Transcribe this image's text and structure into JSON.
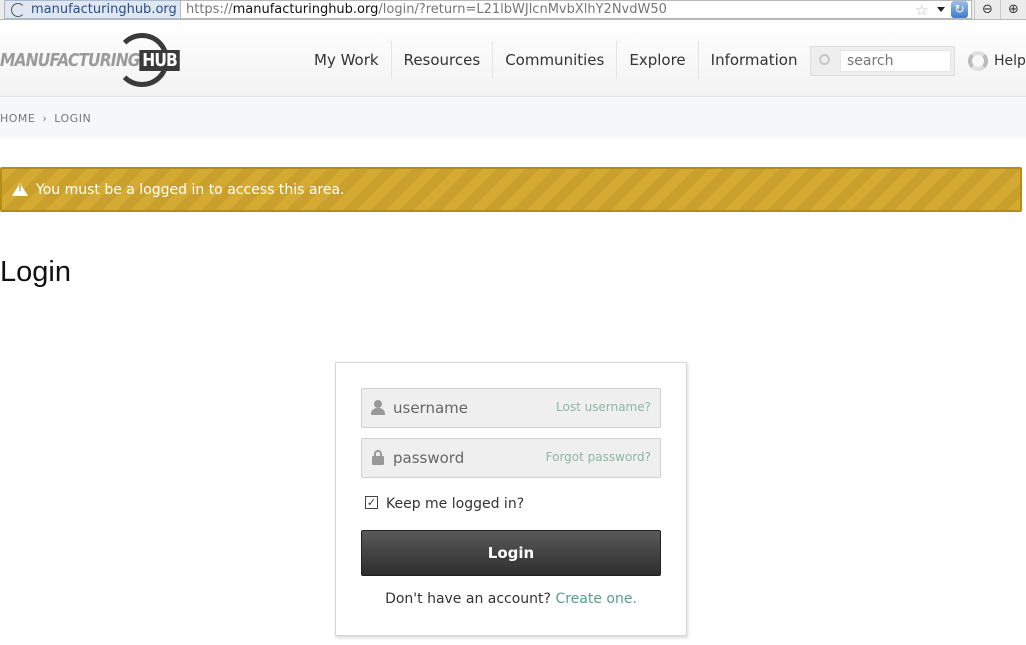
{
  "browser": {
    "site_identity": "manufacturinghub.org",
    "url_prefix": "https://",
    "url_host": "manufacturinghub.org",
    "url_path": "/login/?return=L21lbWJlcnMvbXlhY2NvdW50"
  },
  "header": {
    "logo_text": "MANUFACTURING",
    "logo_hub": "HUB",
    "nav": [
      "My Work",
      "Resources",
      "Communities",
      "Explore",
      "Information"
    ],
    "search_placeholder": "search",
    "help_label": "Help"
  },
  "breadcrumb": {
    "home": "HOME",
    "separator": "›",
    "current": "LOGIN"
  },
  "warning": {
    "message": "You must be a logged in to access this area."
  },
  "page_title": "Login",
  "login_form": {
    "username_placeholder": "username",
    "lost_username": "Lost username?",
    "password_placeholder": "password",
    "forgot_password": "Forgot password?",
    "keep_logged_in": "Keep me logged in?",
    "keep_logged_in_checked": true,
    "login_button": "Login",
    "no_account_text": "Don't have an account?",
    "create_link": "Create one."
  },
  "colors": {
    "warning_bg": "#d4aa33",
    "link": "#5a9e86",
    "button": "#3a3a3a"
  }
}
